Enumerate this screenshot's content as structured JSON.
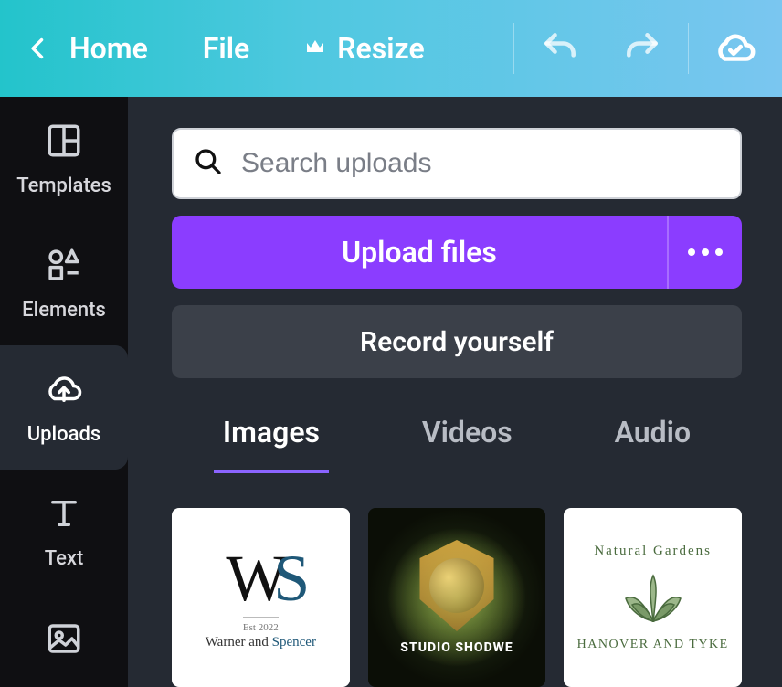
{
  "topbar": {
    "home": "Home",
    "file": "File",
    "resize": "Resize"
  },
  "sidebar": {
    "items": [
      {
        "label": "Templates"
      },
      {
        "label": "Elements"
      },
      {
        "label": "Uploads"
      },
      {
        "label": "Text"
      }
    ]
  },
  "panel": {
    "search_placeholder": "Search uploads",
    "upload_button": "Upload files",
    "record_button": "Record yourself",
    "tabs": [
      {
        "label": "Images"
      },
      {
        "label": "Videos"
      },
      {
        "label": "Audio"
      }
    ],
    "thumbs": {
      "ws": {
        "est": "Est 2022",
        "line_a": "Warner and ",
        "line_b": "Spencer"
      },
      "shodwe": {
        "label": "STUDIO SHODWE"
      },
      "ng": {
        "arc": "Natural Gardens",
        "sub": "HANOVER AND TYKE"
      }
    }
  }
}
